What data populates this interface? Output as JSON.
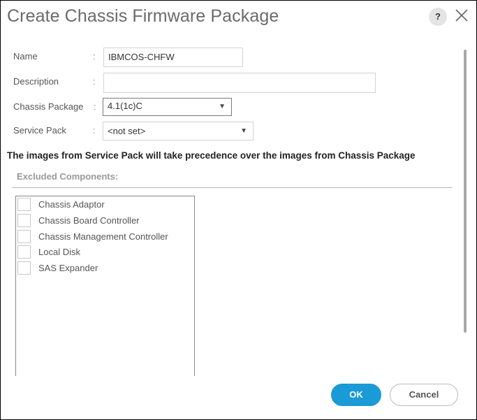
{
  "dialog": {
    "title": "Create Chassis Firmware Package",
    "help_label": "?",
    "close_icon": "close-x-icon"
  },
  "form": {
    "name": {
      "label": "Name",
      "colon": ":",
      "value": "IBMCOS-CHFW"
    },
    "description": {
      "label": "Description",
      "colon": ":",
      "value": ""
    },
    "chassis_package": {
      "label": "Chassis Package",
      "colon": ":",
      "value": "4.1(1c)C",
      "arrow": "▼"
    },
    "service_pack": {
      "label": "Service Pack",
      "colon": ":",
      "value": "<not set>",
      "arrow": "▼"
    }
  },
  "note": "The images from Service Pack will take precedence over the images from Chassis Package",
  "excluded": {
    "heading": "Excluded Components:",
    "items": [
      {
        "label": "Chassis Adaptor",
        "checked": false
      },
      {
        "label": "Chassis Board Controller",
        "checked": false
      },
      {
        "label": "Chassis Management Controller",
        "checked": false
      },
      {
        "label": "Local Disk",
        "checked": false
      },
      {
        "label": "SAS Expander",
        "checked": false
      }
    ]
  },
  "buttons": {
    "ok": "OK",
    "cancel": "Cancel"
  },
  "colors": {
    "primary": "#1a9ad6"
  }
}
